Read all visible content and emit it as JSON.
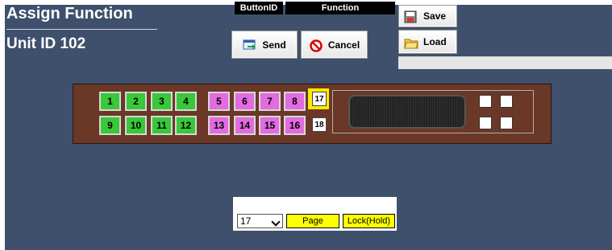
{
  "header": {
    "title": "Assign Function",
    "unit_label": "Unit ID 102"
  },
  "toolbar": {
    "send_label": "Send",
    "cancel_label": "Cancel",
    "save_label": "Save",
    "load_label": "Load"
  },
  "keypad": {
    "top_row": [
      "1",
      "2",
      "3",
      "4",
      "5",
      "6",
      "7",
      "8",
      "17"
    ],
    "bottom_row": [
      "9",
      "10",
      "11",
      "12",
      "13",
      "14",
      "15",
      "16",
      "18"
    ],
    "selected_key": "17"
  },
  "table": {
    "headers": [
      "ButtonID",
      "Function"
    ],
    "button_id_value": "17",
    "function_values": [
      "Page",
      "Lock(Hold)"
    ]
  },
  "colors": {
    "panel": "#3e506c",
    "device": "#6b3727",
    "green_key": "#38c83a",
    "magenta_key": "#e36be0",
    "highlight": "#ffea00"
  }
}
